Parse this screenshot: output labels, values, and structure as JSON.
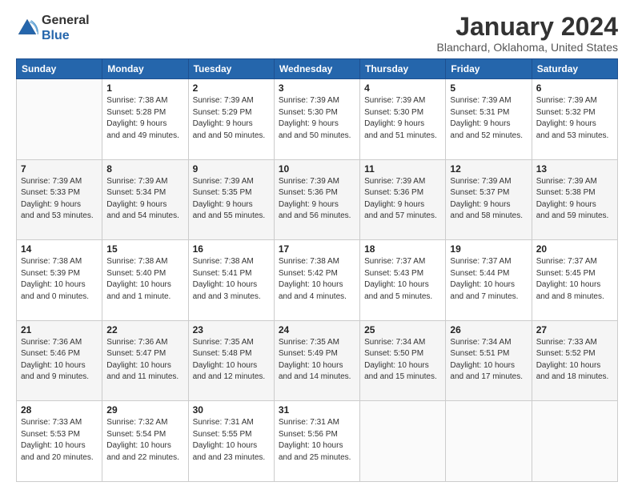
{
  "logo": {
    "line1": "General",
    "line2": "Blue"
  },
  "title": "January 2024",
  "subtitle": "Blanchard, Oklahoma, United States",
  "days_header": [
    "Sunday",
    "Monday",
    "Tuesday",
    "Wednesday",
    "Thursday",
    "Friday",
    "Saturday"
  ],
  "weeks": [
    [
      {
        "day": "",
        "sunrise": "",
        "sunset": "",
        "daylight": ""
      },
      {
        "day": "1",
        "sunrise": "7:38 AM",
        "sunset": "5:28 PM",
        "daylight": "9 hours and 49 minutes."
      },
      {
        "day": "2",
        "sunrise": "7:39 AM",
        "sunset": "5:29 PM",
        "daylight": "9 hours and 50 minutes."
      },
      {
        "day": "3",
        "sunrise": "7:39 AM",
        "sunset": "5:30 PM",
        "daylight": "9 hours and 50 minutes."
      },
      {
        "day": "4",
        "sunrise": "7:39 AM",
        "sunset": "5:30 PM",
        "daylight": "9 hours and 51 minutes."
      },
      {
        "day": "5",
        "sunrise": "7:39 AM",
        "sunset": "5:31 PM",
        "daylight": "9 hours and 52 minutes."
      },
      {
        "day": "6",
        "sunrise": "7:39 AM",
        "sunset": "5:32 PM",
        "daylight": "9 hours and 53 minutes."
      }
    ],
    [
      {
        "day": "7",
        "sunrise": "7:39 AM",
        "sunset": "5:33 PM",
        "daylight": "9 hours and 53 minutes."
      },
      {
        "day": "8",
        "sunrise": "7:39 AM",
        "sunset": "5:34 PM",
        "daylight": "9 hours and 54 minutes."
      },
      {
        "day": "9",
        "sunrise": "7:39 AM",
        "sunset": "5:35 PM",
        "daylight": "9 hours and 55 minutes."
      },
      {
        "day": "10",
        "sunrise": "7:39 AM",
        "sunset": "5:36 PM",
        "daylight": "9 hours and 56 minutes."
      },
      {
        "day": "11",
        "sunrise": "7:39 AM",
        "sunset": "5:36 PM",
        "daylight": "9 hours and 57 minutes."
      },
      {
        "day": "12",
        "sunrise": "7:39 AM",
        "sunset": "5:37 PM",
        "daylight": "9 hours and 58 minutes."
      },
      {
        "day": "13",
        "sunrise": "7:39 AM",
        "sunset": "5:38 PM",
        "daylight": "9 hours and 59 minutes."
      }
    ],
    [
      {
        "day": "14",
        "sunrise": "7:38 AM",
        "sunset": "5:39 PM",
        "daylight": "10 hours and 0 minutes."
      },
      {
        "day": "15",
        "sunrise": "7:38 AM",
        "sunset": "5:40 PM",
        "daylight": "10 hours and 1 minute."
      },
      {
        "day": "16",
        "sunrise": "7:38 AM",
        "sunset": "5:41 PM",
        "daylight": "10 hours and 3 minutes."
      },
      {
        "day": "17",
        "sunrise": "7:38 AM",
        "sunset": "5:42 PM",
        "daylight": "10 hours and 4 minutes."
      },
      {
        "day": "18",
        "sunrise": "7:37 AM",
        "sunset": "5:43 PM",
        "daylight": "10 hours and 5 minutes."
      },
      {
        "day": "19",
        "sunrise": "7:37 AM",
        "sunset": "5:44 PM",
        "daylight": "10 hours and 7 minutes."
      },
      {
        "day": "20",
        "sunrise": "7:37 AM",
        "sunset": "5:45 PM",
        "daylight": "10 hours and 8 minutes."
      }
    ],
    [
      {
        "day": "21",
        "sunrise": "7:36 AM",
        "sunset": "5:46 PM",
        "daylight": "10 hours and 9 minutes."
      },
      {
        "day": "22",
        "sunrise": "7:36 AM",
        "sunset": "5:47 PM",
        "daylight": "10 hours and 11 minutes."
      },
      {
        "day": "23",
        "sunrise": "7:35 AM",
        "sunset": "5:48 PM",
        "daylight": "10 hours and 12 minutes."
      },
      {
        "day": "24",
        "sunrise": "7:35 AM",
        "sunset": "5:49 PM",
        "daylight": "10 hours and 14 minutes."
      },
      {
        "day": "25",
        "sunrise": "7:34 AM",
        "sunset": "5:50 PM",
        "daylight": "10 hours and 15 minutes."
      },
      {
        "day": "26",
        "sunrise": "7:34 AM",
        "sunset": "5:51 PM",
        "daylight": "10 hours and 17 minutes."
      },
      {
        "day": "27",
        "sunrise": "7:33 AM",
        "sunset": "5:52 PM",
        "daylight": "10 hours and 18 minutes."
      }
    ],
    [
      {
        "day": "28",
        "sunrise": "7:33 AM",
        "sunset": "5:53 PM",
        "daylight": "10 hours and 20 minutes."
      },
      {
        "day": "29",
        "sunrise": "7:32 AM",
        "sunset": "5:54 PM",
        "daylight": "10 hours and 22 minutes."
      },
      {
        "day": "30",
        "sunrise": "7:31 AM",
        "sunset": "5:55 PM",
        "daylight": "10 hours and 23 minutes."
      },
      {
        "day": "31",
        "sunrise": "7:31 AM",
        "sunset": "5:56 PM",
        "daylight": "10 hours and 25 minutes."
      },
      {
        "day": "",
        "sunrise": "",
        "sunset": "",
        "daylight": ""
      },
      {
        "day": "",
        "sunrise": "",
        "sunset": "",
        "daylight": ""
      },
      {
        "day": "",
        "sunrise": "",
        "sunset": "",
        "daylight": ""
      }
    ]
  ],
  "labels": {
    "sunrise_prefix": "Sunrise: ",
    "sunset_prefix": "Sunset: ",
    "daylight_prefix": "Daylight: "
  }
}
